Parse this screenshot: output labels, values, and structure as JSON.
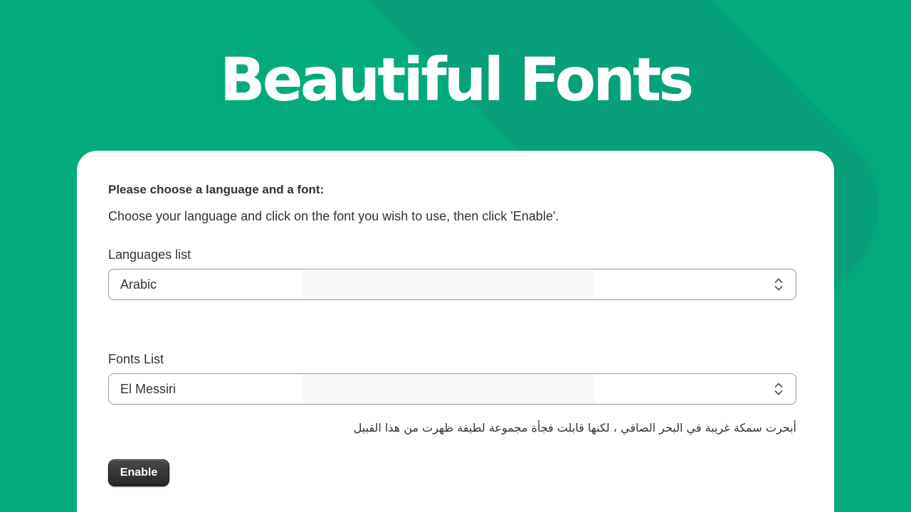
{
  "hero": {
    "title": "Beautiful Fonts"
  },
  "form": {
    "heading": "Please choose a language and a font:",
    "instructions": "Choose your language and click on the font you wish to use, then click 'Enable'.",
    "languages": {
      "label": "Languages list",
      "selected": "Arabic"
    },
    "fonts": {
      "label": "Fonts List",
      "selected": "El Messiri"
    },
    "preview_text": "أبحرت سمكة غريبة في البحر الصافي ، لكنها قابلت فجأة مجموعة لطيفة ظهرت من هذا القبيل",
    "enable_label": "Enable"
  },
  "colors": {
    "background": "#03ab7c",
    "band": "#07a07a",
    "card": "#ffffff",
    "button": "#2f2f2f",
    "text": "#333333"
  },
  "icons": {
    "select_indicator": "chevron-up-down-icon"
  }
}
